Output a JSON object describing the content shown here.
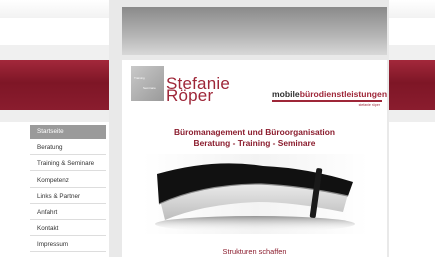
{
  "logo": {
    "box_line1": "Training",
    "box_line2": "Seminare",
    "name_first": "Stefanie",
    "name_last": "Röper"
  },
  "brand": {
    "part1": "mobile",
    "part2": "bürodienstleistungen",
    "sub": "stefanie röper"
  },
  "nav": {
    "items": [
      {
        "label": "Startseite",
        "active": true
      },
      {
        "label": "Beratung"
      },
      {
        "label": "Training & Seminare"
      },
      {
        "label": "Kompetenz"
      },
      {
        "label": "Links & Partner"
      },
      {
        "label": "Anfahrt"
      },
      {
        "label": "Kontakt"
      },
      {
        "label": "Impressum"
      }
    ]
  },
  "main": {
    "heading_line1": "Büromanagement und Büroorganisation",
    "heading_line2": "Beratung - Training - Seminare",
    "bottom_text": "Strukturen schaffen"
  },
  "colors": {
    "accent": "#9e2638",
    "band": "#7e1626",
    "active_nav": "#9a9a9a"
  }
}
